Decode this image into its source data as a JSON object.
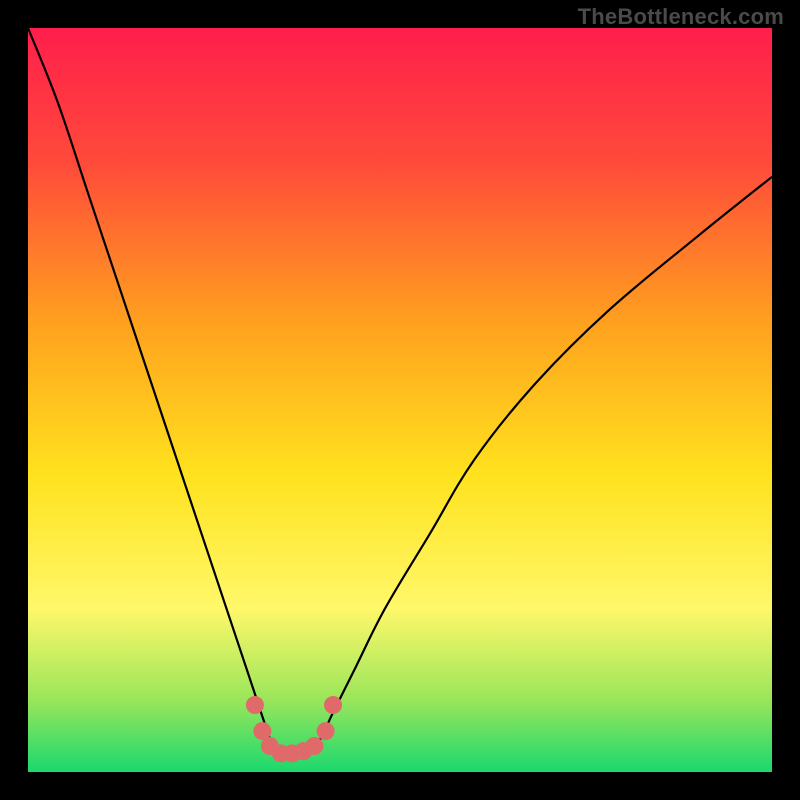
{
  "watermark": "TheBottleneck.com",
  "chart_data": {
    "type": "line",
    "title": "",
    "xlabel": "",
    "ylabel": "",
    "xlim": [
      0,
      100
    ],
    "ylim": [
      0,
      100
    ],
    "gradient_stops": [
      {
        "offset": 0.0,
        "color": "#ff1e4c"
      },
      {
        "offset": 0.18,
        "color": "#ff4a3a"
      },
      {
        "offset": 0.4,
        "color": "#ffa21e"
      },
      {
        "offset": 0.6,
        "color": "#ffe21e"
      },
      {
        "offset": 0.78,
        "color": "#fff86a"
      },
      {
        "offset": 0.9,
        "color": "#9de65a"
      },
      {
        "offset": 1.0,
        "color": "#1bd86e"
      }
    ],
    "series": [
      {
        "name": "bottleneck-curve",
        "x": [
          0,
          4,
          8,
          12,
          16,
          20,
          24,
          28,
          30,
          32,
          33.5,
          35,
          37,
          39,
          41,
          44,
          48,
          54,
          60,
          68,
          78,
          90,
          100
        ],
        "values": [
          100,
          90,
          78,
          66,
          54,
          42,
          30,
          18,
          12,
          6,
          2,
          3,
          3,
          4,
          8,
          14,
          22,
          32,
          42,
          52,
          62,
          72,
          80
        ]
      },
      {
        "name": "highlight-dots",
        "x": [
          30.5,
          31.5,
          32.5,
          34.0,
          35.5,
          37.0,
          38.5,
          40.0,
          41.0
        ],
        "values": [
          9.0,
          5.5,
          3.5,
          2.5,
          2.5,
          2.8,
          3.5,
          5.5,
          9.0
        ]
      }
    ]
  }
}
